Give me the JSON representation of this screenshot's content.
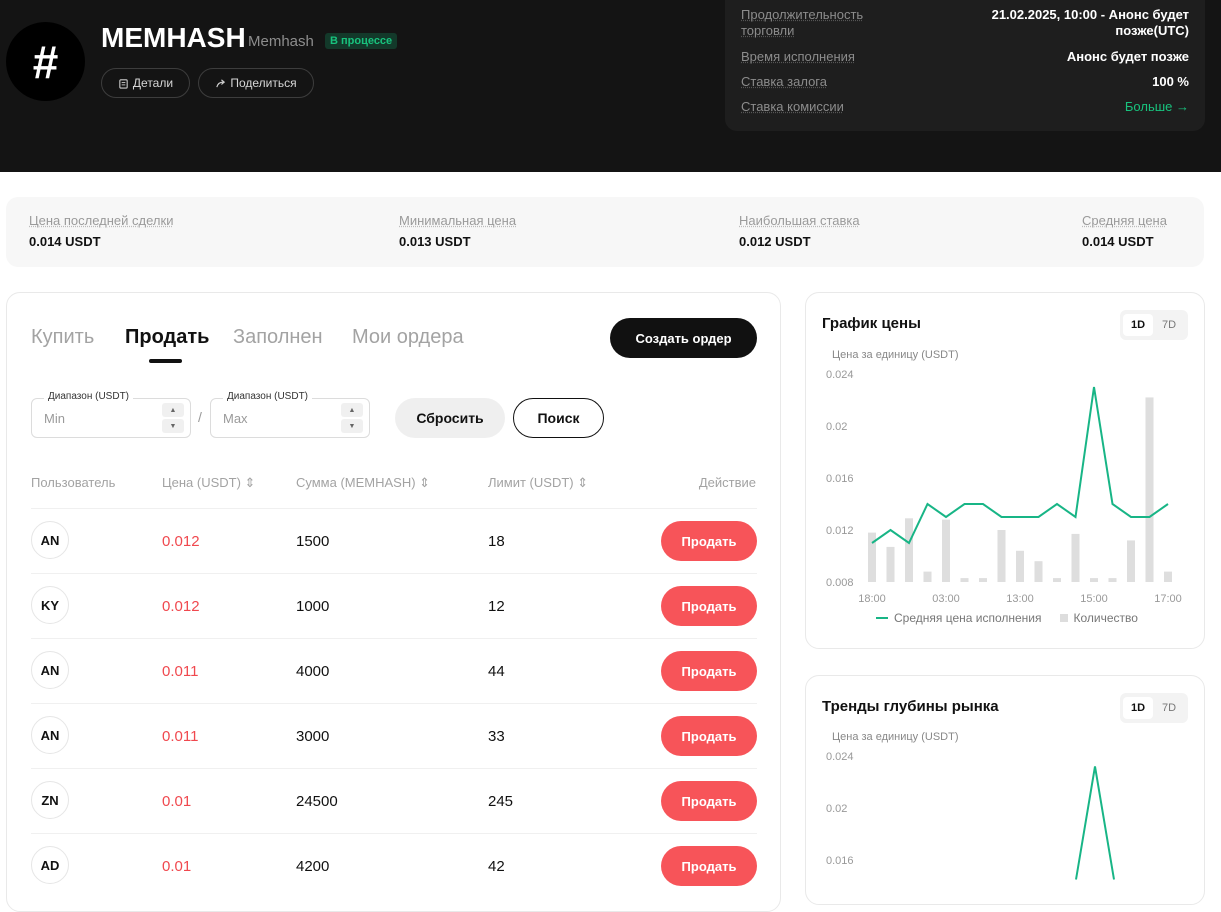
{
  "header": {
    "logo_glyph": "#",
    "token_name": "MEMHASH",
    "token_sub": "Memhash",
    "status_badge": "В процессе",
    "details_label": "Детали",
    "share_label": "Поделиться"
  },
  "info": [
    {
      "key": "Продолжительность торговли",
      "value": "21.02.2025, 10:00 - Анонс будет позже(UTC)"
    },
    {
      "key": "Время исполнения",
      "value": "Анонс будет позже"
    },
    {
      "key": "Ставка залога",
      "value": "100 %"
    },
    {
      "key": "Ставка комиссии",
      "value": "Больше →"
    }
  ],
  "stats": [
    {
      "key": "Цена последней сделки",
      "value": "0.014 USDT"
    },
    {
      "key": "Минимальная цена",
      "value": "0.013 USDT"
    },
    {
      "key": "Наибольшая ставка",
      "value": "0.012 USDT"
    },
    {
      "key": "Средняя цена",
      "value": "0.014 USDT"
    }
  ],
  "tabs": [
    "Купить",
    "Продать",
    "Заполнен",
    "Мои ордера"
  ],
  "active_tab": "Продать",
  "create_order_label": "Создать ордер",
  "filters": {
    "min_label": "Диапазон (USDT)",
    "min_placeholder": "Min",
    "max_label": "Диапазон (USDT)",
    "max_placeholder": "Max",
    "separator": "/",
    "reset_label": "Сбросить",
    "search_label": "Поиск"
  },
  "table": {
    "headers": [
      "Пользователь",
      "Цена (USDT) ⇕",
      "Сумма (MEMHASH) ⇕",
      "Лимит (USDT) ⇕",
      "Действие"
    ],
    "rows": [
      {
        "user": "AN",
        "price": "0.012",
        "amount": "1500",
        "limit": "18",
        "action": "Продать"
      },
      {
        "user": "KY",
        "price": "0.012",
        "amount": "1000",
        "limit": "12",
        "action": "Продать"
      },
      {
        "user": "AN",
        "price": "0.011",
        "amount": "4000",
        "limit": "44",
        "action": "Продать"
      },
      {
        "user": "AN",
        "price": "0.011",
        "amount": "3000",
        "limit": "33",
        "action": "Продать"
      },
      {
        "user": "ZN",
        "price": "0.01",
        "amount": "24500",
        "limit": "245",
        "action": "Продать"
      },
      {
        "user": "AD",
        "price": "0.01",
        "amount": "4200",
        "limit": "42",
        "action": "Продать"
      }
    ]
  },
  "price_chart": {
    "title": "График цены",
    "toggle_active": "1D",
    "toggle_other": "7D",
    "ylabel": "Цена за единицу (USDT)",
    "legend_line": "Средняя цена исполнения",
    "legend_bar": "Количество"
  },
  "depth_chart": {
    "title": "Тренды глубины рынка",
    "toggle_active": "1D",
    "toggle_other": "7D",
    "ylabel": "Цена за единицу (USDT)"
  },
  "chart_data": [
    {
      "type": "line",
      "title": "График цены",
      "ylabel": "Цена за единицу (USDT)",
      "ylim": [
        0.008,
        0.024
      ],
      "yticks": [
        "0.024",
        "0.02",
        "0.016",
        "0.012",
        "0.008"
      ],
      "xticks": [
        "18:00",
        "03:00",
        "13:00",
        "15:00",
        "17:00"
      ],
      "series": [
        {
          "name": "Средняя цена исполнения",
          "values": [
            0.011,
            0.012,
            0.011,
            0.014,
            0.013,
            0.014,
            0.014,
            0.013,
            0.013,
            0.013,
            0.014,
            0.013,
            0.023,
            0.014,
            0.013,
            0.013,
            0.014
          ]
        },
        {
          "name": "Количество",
          "values": [
            0.0118,
            0.0107,
            0.0129,
            0.0088,
            0.0128,
            0.0083,
            0.0083,
            0.012,
            0.0104,
            0.0096,
            0.0083,
            0.0117,
            0.0083,
            0.0083,
            0.0112,
            0.0222,
            0.0088
          ]
        }
      ],
      "grid": false,
      "legend": "bottom"
    },
    {
      "type": "line",
      "title": "Тренды глубины рынка",
      "ylabel": "Цена за единицу (USDT)",
      "ylim": [
        0.008,
        0.024
      ],
      "yticks": [
        "0.024",
        "0.02",
        "0.016"
      ],
      "series": [
        {
          "name": "",
          "values": [
            0.0145,
            0.0232,
            0.0145
          ]
        }
      ]
    }
  ],
  "colors": {
    "accent_green": "#18c27d",
    "sell_red": "#f75459",
    "price_red": "#f0484e",
    "dark": "#141414"
  },
  "icons": {
    "details": "clipboard-icon",
    "share": "share-arrow-icon"
  }
}
